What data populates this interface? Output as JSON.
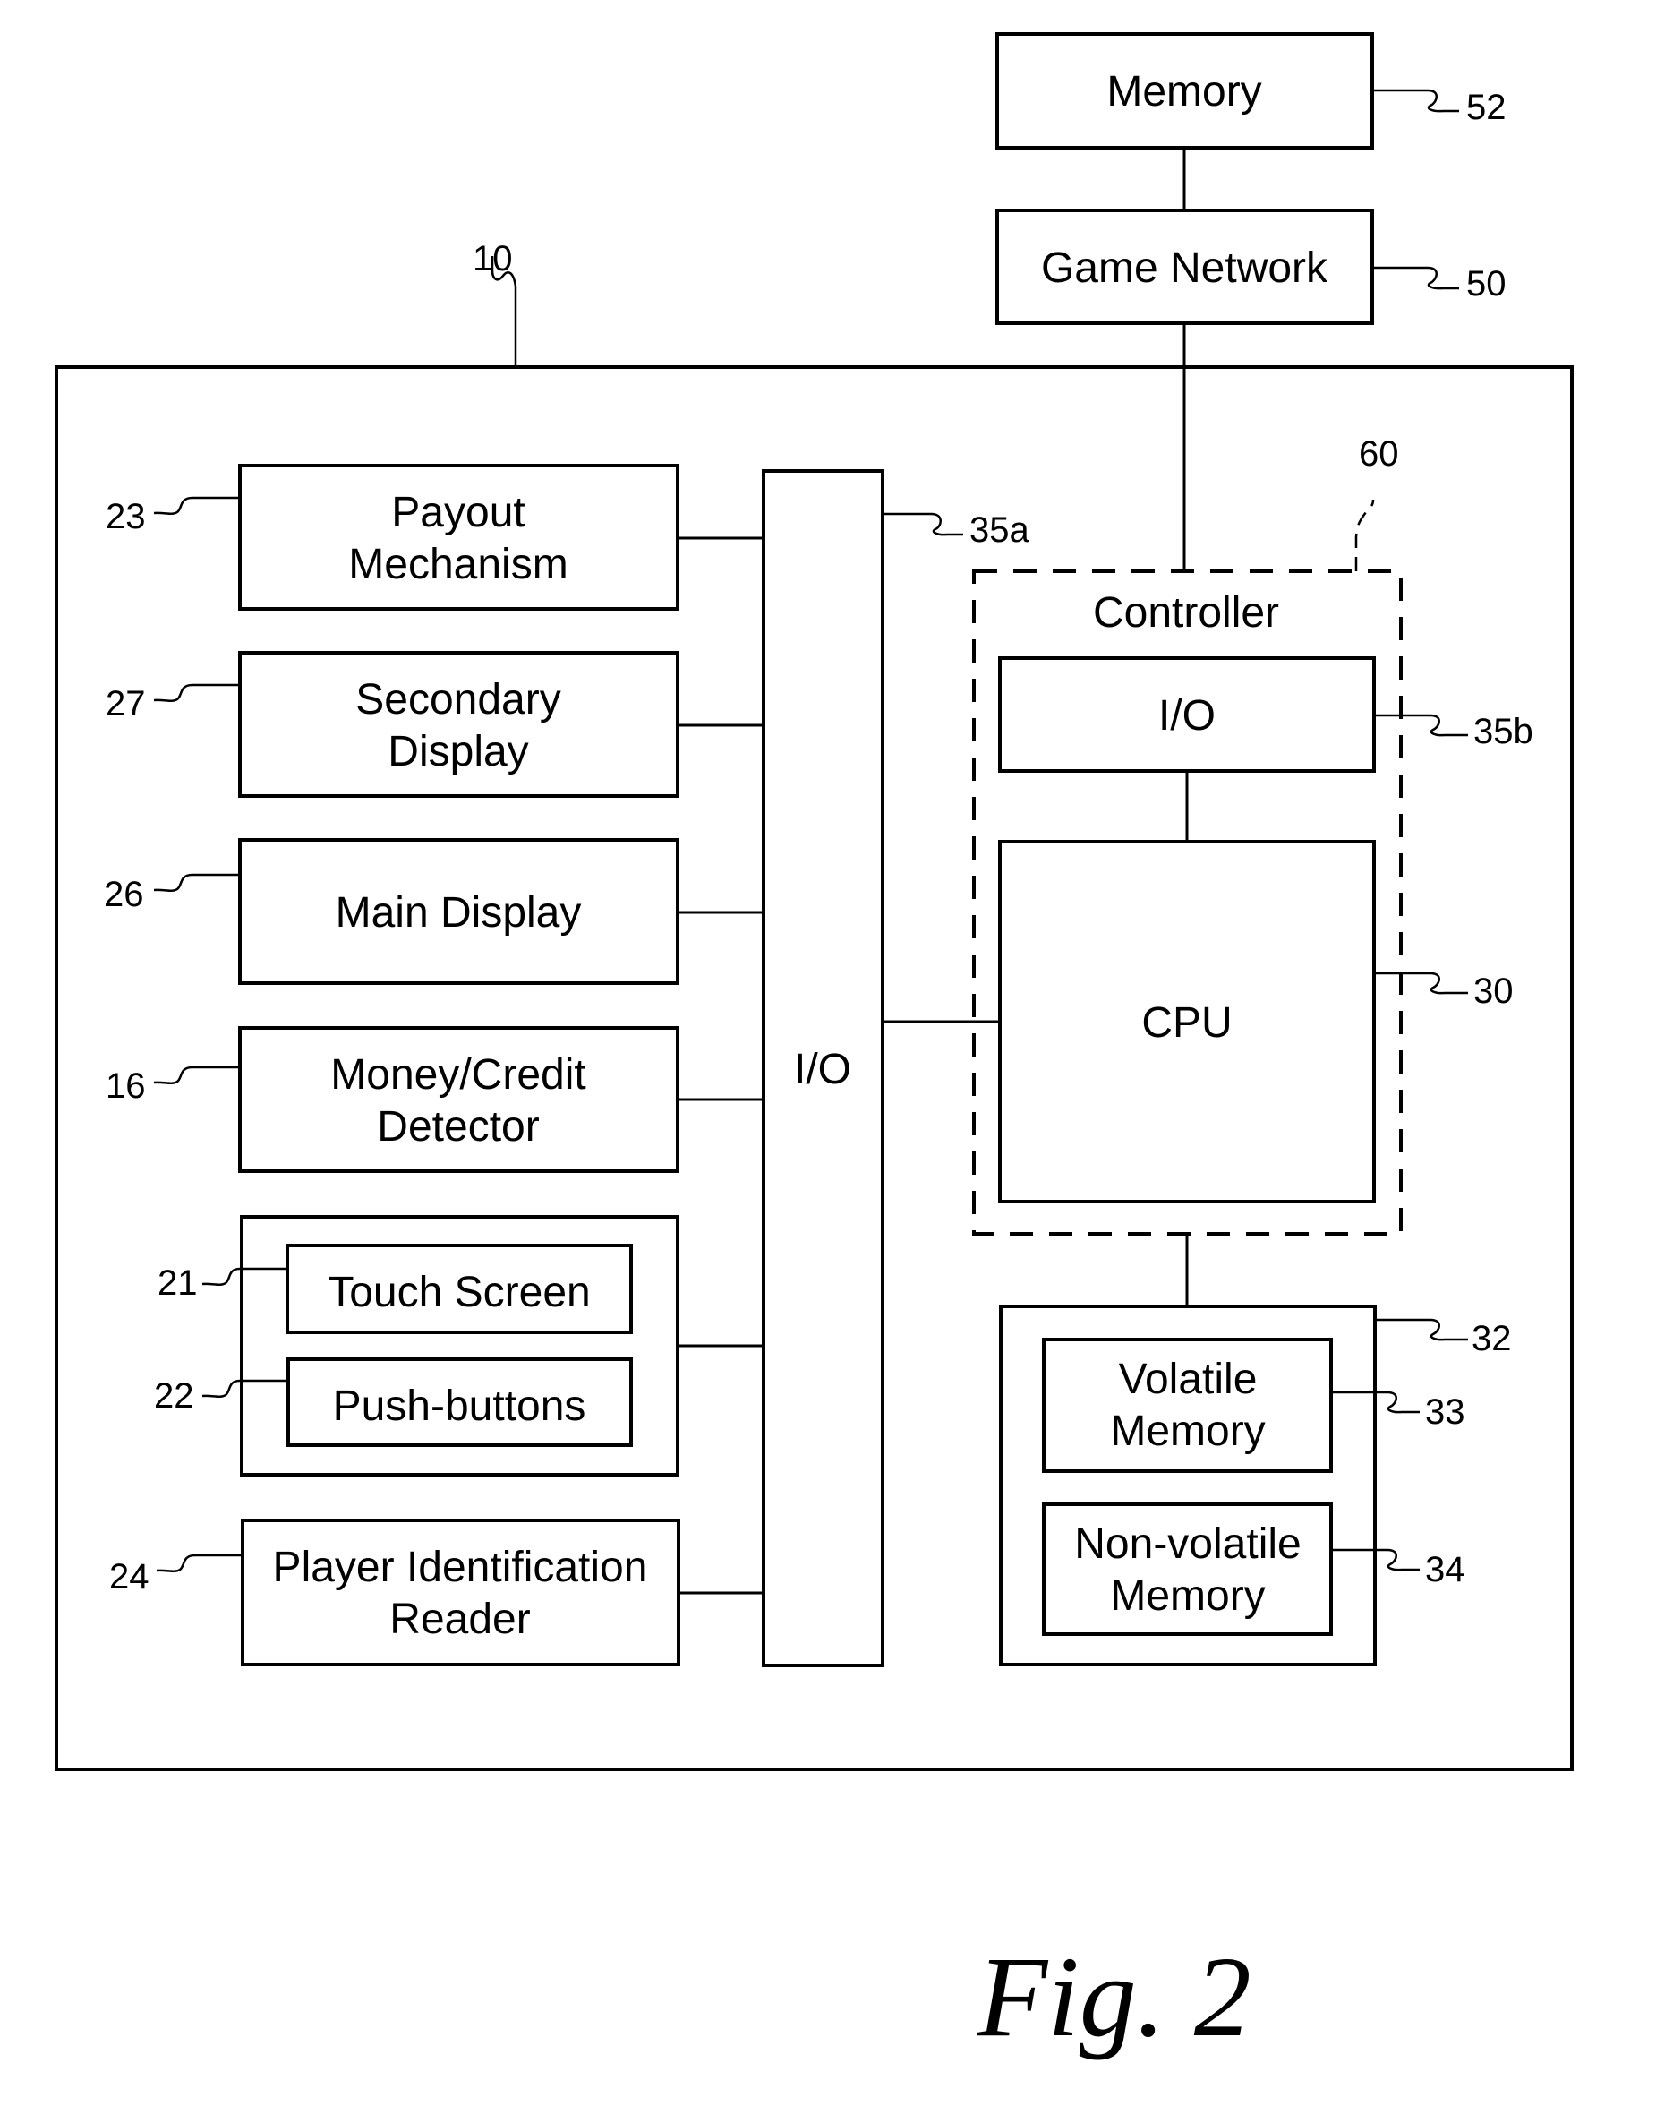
{
  "figure": {
    "caption": "Fig. 2",
    "external": {
      "memory": {
        "label": "Memory",
        "ref": "52"
      },
      "game_network": {
        "label": "Game Network",
        "ref": "50"
      }
    },
    "gaming_machine": {
      "ref": "10"
    },
    "peripherals": [
      {
        "lines": [
          "Payout",
          "Mechanism"
        ],
        "ref": "23"
      },
      {
        "lines": [
          "Secondary",
          "Display"
        ],
        "ref": "27"
      },
      {
        "lines": [
          "Main Display"
        ],
        "ref": "26"
      },
      {
        "lines": [
          "Money/Credit",
          "Detector"
        ],
        "ref": "16"
      },
      {
        "lines": [
          "Player Identification",
          "Reader"
        ],
        "ref": "24"
      }
    ],
    "input_group": {
      "touch_screen": {
        "label": "Touch Screen",
        "ref": "21"
      },
      "push_buttons": {
        "label": "Push-buttons",
        "ref": "22"
      }
    },
    "io_bus": {
      "label": "I/O",
      "ref": "35a"
    },
    "controller": {
      "label": "Controller",
      "ref": "60",
      "io": {
        "label": "I/O",
        "ref": "35b"
      },
      "cpu": {
        "label": "CPU",
        "ref": "30"
      }
    },
    "memory_unit": {
      "ref": "32",
      "volatile": {
        "lines": [
          "Volatile",
          "Memory"
        ],
        "ref": "33"
      },
      "nonvolatile": {
        "lines": [
          "Non-volatile",
          "Memory"
        ],
        "ref": "34"
      }
    }
  }
}
